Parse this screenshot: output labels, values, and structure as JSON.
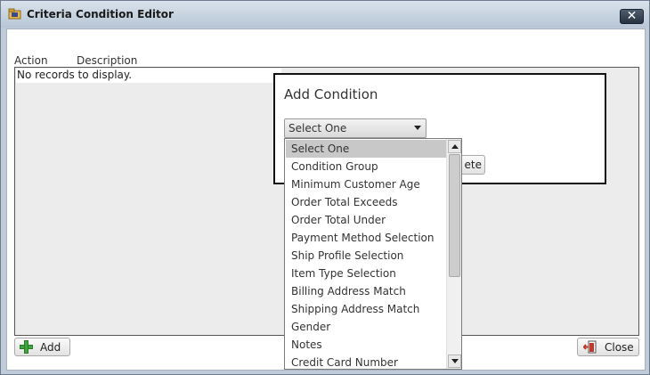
{
  "window": {
    "title": "Criteria Condition Editor",
    "close_glyph": "✕",
    "icon": "folder-app-icon"
  },
  "grid": {
    "columns": [
      "Action",
      "Description"
    ],
    "empty_text": "No records to display."
  },
  "footer": {
    "add_label": "Add",
    "close_label": "Close"
  },
  "dialog": {
    "title": "Add Condition",
    "select_value": "Select One",
    "button_partial_label": "ete"
  },
  "dropdown": {
    "items": [
      "Select One",
      "Condition Group",
      "Minimum Customer Age",
      "Order Total Exceeds",
      "Order Total Under",
      "Payment Method Selection",
      "Ship Profile Selection",
      "Item Type Selection",
      "Billing Address Match",
      "Shipping Address Match",
      "Gender",
      "Notes",
      "Credit Card Number"
    ],
    "selected": "Select One"
  },
  "colors": {
    "titlebar": "#c4d0dd",
    "selected_item": "#c8c8c8",
    "add_icon": "#3fa63f"
  }
}
